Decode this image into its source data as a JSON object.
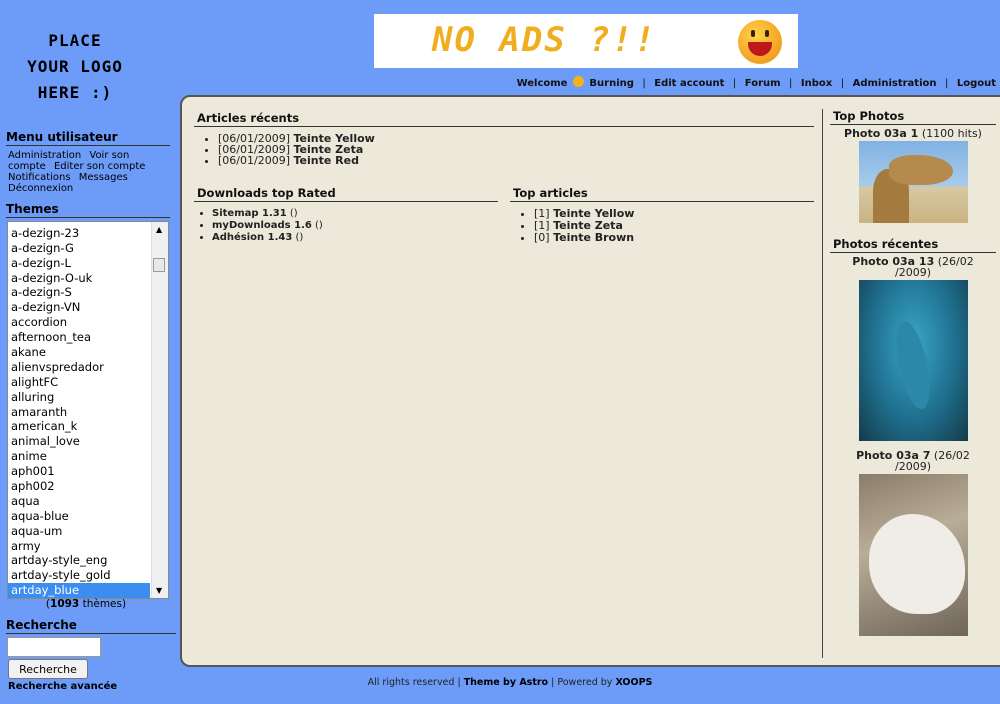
{
  "logo": {
    "line1": "PLACE",
    "line2": "YOUR LOGO",
    "line3": "HERE :)"
  },
  "ad": {
    "text": "NO ADS ?!!"
  },
  "topnav": {
    "welcome": "Welcome",
    "user": "Burning",
    "edit_account": "Edit account",
    "forum": "Forum",
    "inbox": "Inbox",
    "administration": "Administration",
    "logout": "Logout"
  },
  "sidebar": {
    "menu_title": "Menu utilisateur",
    "menu_items": [
      "Administration",
      "Voir son compte",
      "Editer son compte",
      "Notifications",
      "Messages",
      "Déconnexion"
    ],
    "themes_title": "Themes",
    "themes": [
      "a-dezign-23",
      "a-dezign-G",
      "a-dezign-L",
      "a-dezign-O-uk",
      "a-dezign-S",
      "a-dezign-VN",
      "accordion",
      "afternoon_tea",
      "akane",
      "alienvspredador",
      "alightFC",
      "alluring",
      "amaranth",
      "american_k",
      "animal_love",
      "anime",
      "aph001",
      "aph002",
      "aqua",
      "aqua-blue",
      "aqua-um",
      "army",
      "artday-style_eng",
      "artday-style_gold",
      "artday_blue"
    ],
    "selected_theme": "artday_blue",
    "theme_count": "1093",
    "theme_count_suffix": "thèmes",
    "search_title": "Recherche",
    "search_button": "Recherche",
    "advanced_search": "Recherche avancée"
  },
  "articles": {
    "title": "Articles récents",
    "items": [
      {
        "date": "[06/01/2009]",
        "name": "Teinte Yellow"
      },
      {
        "date": "[06/01/2009]",
        "name": "Teinte Zeta"
      },
      {
        "date": "[06/01/2009]",
        "name": "Teinte Red"
      }
    ]
  },
  "downloads": {
    "title": "Downloads top Rated",
    "items": [
      {
        "name": "Sitemap 1.31",
        "count": "()"
      },
      {
        "name": "myDownloads 1.6",
        "count": "()"
      },
      {
        "name": "Adhésion 1.43",
        "count": "()"
      }
    ]
  },
  "top_articles": {
    "title": "Top articles",
    "items": [
      {
        "rank": "[1]",
        "name": "Teinte Yellow"
      },
      {
        "rank": "[1]",
        "name": "Teinte Zeta"
      },
      {
        "rank": "[0]",
        "name": "Teinte Brown"
      }
    ]
  },
  "top_photos": {
    "title": "Top Photos",
    "caption": "Photo 03a 1",
    "hits": "(1100 hits)"
  },
  "recent_photos": {
    "title": "Photos récentes",
    "items": [
      {
        "caption": "Photo 03a 13",
        "date1": "(26/02",
        "date2": "/2009)"
      },
      {
        "caption": "Photo 03a 7",
        "date1": "(26/02",
        "date2": "/2009)"
      }
    ]
  },
  "footer": {
    "rights": "All rights reserved",
    "theme": "Theme by Astro",
    "powered": "Powered by",
    "xoops": "XOOPS"
  },
  "colors": {
    "background": "#6c9cf8",
    "panel": "#ece9db",
    "selected": "#3c8df0"
  }
}
